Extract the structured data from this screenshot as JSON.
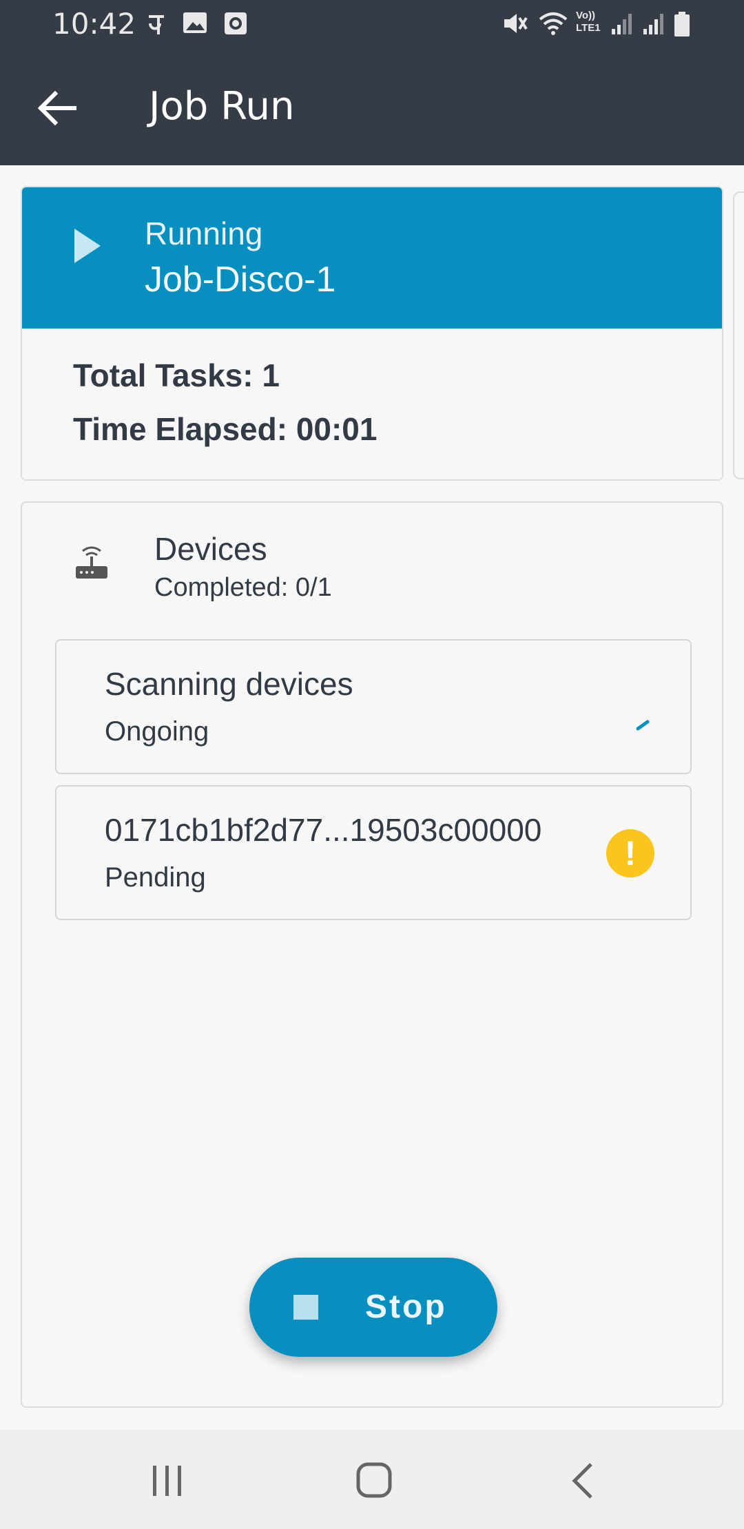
{
  "status_bar": {
    "time": "10:42",
    "left_icons": [
      "phonepe-icon",
      "image-icon",
      "clock-app-icon"
    ],
    "right_icons": [
      "mute-icon",
      "wifi-icon",
      "volte-icon",
      "signal-icon",
      "signal-icon",
      "battery-icon"
    ],
    "volte_text": "Vo)) LTE1"
  },
  "app_bar": {
    "title": "Job Run",
    "back_icon": "arrow-left-icon"
  },
  "job_card": {
    "state": "Running",
    "name": "Job-Disco-1",
    "total_tasks_line": "Total Tasks: 1",
    "time_elapsed_line": "Time Elapsed: 00:01",
    "header_color": "#078fbf"
  },
  "devices_card": {
    "title": "Devices",
    "subtitle": "Completed: 0/1",
    "icon": "router-icon",
    "tasks": [
      {
        "title": "Scanning devices",
        "status": "Ongoing",
        "indicator": "spinner-icon"
      },
      {
        "title": "0171cb1bf2d77...19503c00000",
        "status": "Pending",
        "indicator": "warning-icon",
        "indicator_text": "!"
      }
    ],
    "stop_button": {
      "label": "Stop",
      "icon": "stop-square-icon"
    }
  },
  "nav_bar": {
    "buttons": [
      "recents-icon",
      "home-icon",
      "back-nav-icon"
    ]
  },
  "colors": {
    "primary": "#078fbf",
    "app_bar": "#363c45",
    "warning": "#fbc51d",
    "text": "#323a45"
  }
}
